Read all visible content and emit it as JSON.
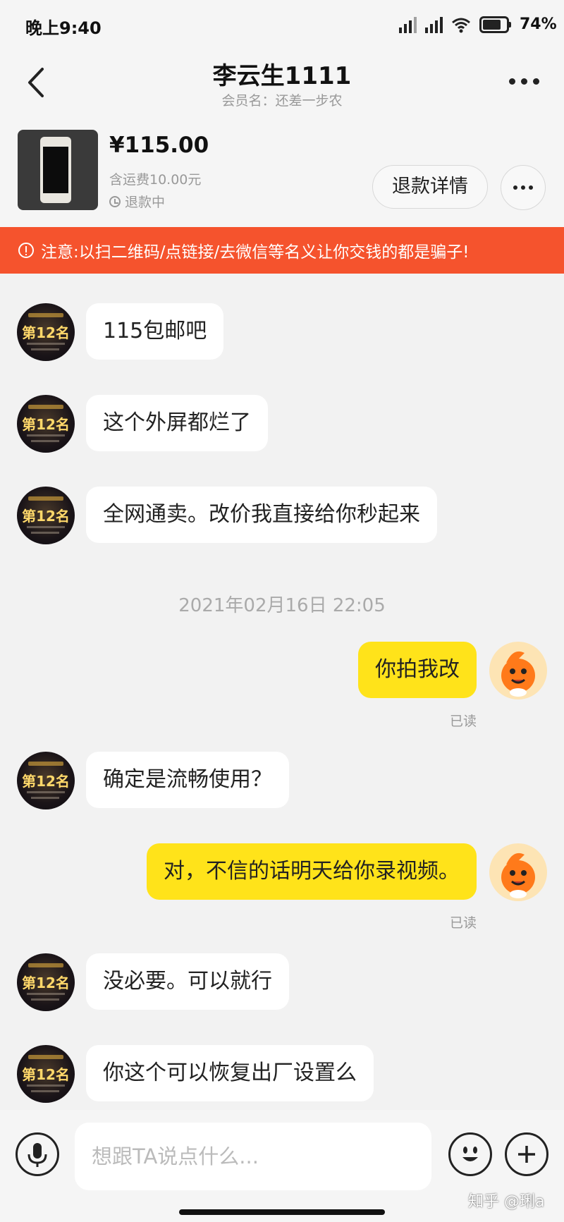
{
  "status": {
    "time": "晚上9:40",
    "battery": "74%"
  },
  "header": {
    "title": "李云生1111",
    "subtitle": "会员名：还差一步农"
  },
  "product": {
    "price": "¥115.00",
    "shipping": "含运费10.00元",
    "status": "退款中",
    "refund_button": "退款详情"
  },
  "warning": {
    "text": "注意:以扫二维码/点链接/去微信等名义让你交钱的都是骗子!"
  },
  "chat": {
    "m1": "115包邮吧",
    "m2": "这个外屏都烂了",
    "m3": "全网通卖。改价我直接给你秒起来",
    "timestamp": "2021年02月16日 22:05",
    "m4": "你拍我改",
    "m4_read": "已读",
    "m5": "确定是流畅使用？",
    "m6": "对，不信的话明天给你录视频。",
    "m6_read": "已读",
    "m7": "没必要。可以就行",
    "m8": "你这个可以恢复出厂设置么",
    "avatar_text": "第12名"
  },
  "input": {
    "placeholder": "想跟TA说点什么..."
  },
  "watermark": "知乎 @琍a",
  "colors": {
    "warning": "#f5532d",
    "my_bubble": "#ffe31a",
    "background": "#f2f2f2"
  }
}
